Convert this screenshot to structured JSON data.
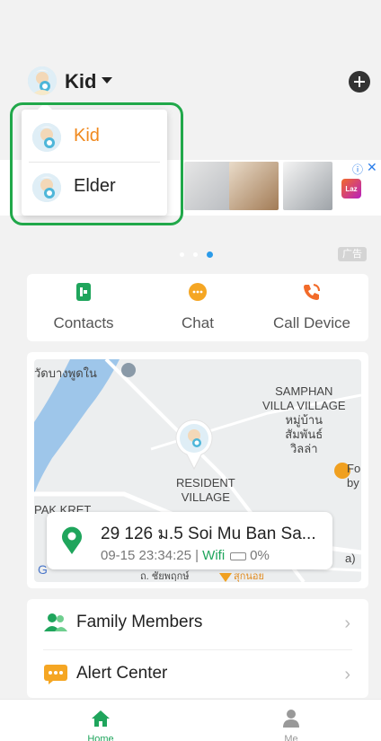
{
  "header": {
    "profile_name": "Kid",
    "avatar_icon": "kid-avatar-icon",
    "add_icon": "plus-circle-icon"
  },
  "profile_dropdown": {
    "items": [
      {
        "label": "Kid",
        "selected": true
      },
      {
        "label": "Elder",
        "selected": false
      }
    ]
  },
  "ad": {
    "info_icon": "ⓘ",
    "close_icon": "✕",
    "brand": "Laz",
    "tag": "广告",
    "carousel_active_index": 2,
    "carousel_count": 3
  },
  "quick_actions": [
    {
      "label": "Contacts",
      "icon": "contacts-icon",
      "color": "#1fa55c"
    },
    {
      "label": "Chat",
      "icon": "chat-icon",
      "color": "#f5a623"
    },
    {
      "label": "Call Device",
      "icon": "call-device-icon",
      "color": "#f26b2a"
    }
  ],
  "map": {
    "labels": {
      "top_left": "วัดบางพูดใน",
      "samphan": "SAMPHAN\nVILLA VILLAGE\nหมู่บ้าน\nสัมพันธ์\nวิลล่า",
      "resident": "RESIDENT\nVILLAGE",
      "pak": "PAK KRET",
      "fo": "Fo\nby",
      "road": "ถ. ชัยพฤกษ์",
      "shop": "สุกนอย",
      "right_a": "a)",
      "google": "G"
    }
  },
  "location": {
    "address": "29 126 ม.5 Soi Mu Ban Sa...",
    "time": "09-15 23:34:25 | ",
    "network": "Wifi",
    "battery": "0%"
  },
  "menu": [
    {
      "label": "Family Members",
      "icon": "family-members-icon"
    },
    {
      "label": "Alert Center",
      "icon": "alert-center-icon"
    }
  ],
  "tabs": [
    {
      "label": "Home",
      "icon": "home-icon",
      "active": true
    },
    {
      "label": "Me",
      "icon": "person-icon",
      "active": false
    }
  ],
  "colors": {
    "accent_green": "#1fa55c",
    "selected_orange": "#f0891e",
    "highlight_green": "#21a84a",
    "carousel_blue": "#2b9be9"
  }
}
